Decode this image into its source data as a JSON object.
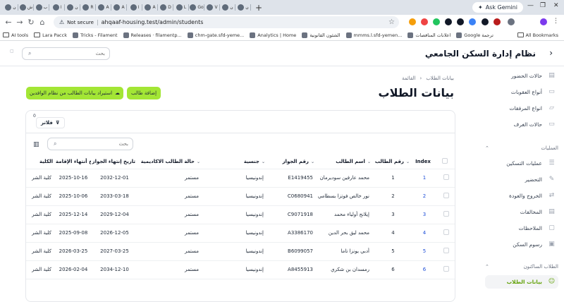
{
  "browser": {
    "tabs": [
      "ن",
      "ش",
      "ب",
      "ا",
      "ن",
      "R",
      "A",
      "A",
      "ا",
      "A",
      "D",
      "L",
      "Go",
      "V",
      "ن",
      "ن"
    ],
    "active_tab_label": "ن",
    "new_tab": "+",
    "ask_gemini": "Ask Gemini",
    "not_secure": "Not secure",
    "url": "ahqaaf-housing.test/admin/students",
    "bookmarks": [
      "AI tools",
      "Lara Pacck",
      "Tricks - Filament",
      "Releases · filamentp...",
      "chm-gate.sfd-yeme...",
      "Analytics | Home",
      "الشئون القانونية",
      "mmms.l.sfd-yemen...",
      "اعلانات المناقصات",
      "Google ترجمة",
      "All Bookmarks"
    ]
  },
  "app": {
    "brand": "نظام إدارة السكن الجامعي",
    "search_placeholder": "بحث"
  },
  "sidebar": {
    "items_top": [
      {
        "label": "حالات الحضور",
        "icon": "clipboard-icon"
      },
      {
        "label": "أنواع العقوبات",
        "icon": "document-icon"
      },
      {
        "label": "انواع المرفقات",
        "icon": "folder-icon"
      },
      {
        "label": "حالات الغرف",
        "icon": "document-icon"
      }
    ],
    "group_operations": "العمليات",
    "items_ops": [
      {
        "label": "عمليات التسكين",
        "icon": "list-icon"
      },
      {
        "label": "التحضير",
        "icon": "pencil-icon"
      },
      {
        "label": "الخروج والعودة",
        "icon": "arrows-icon"
      },
      {
        "label": "المخالفات",
        "icon": "clipboard-icon"
      },
      {
        "label": "الملاحظات",
        "icon": "chat-icon"
      },
      {
        "label": "رسوم السكن",
        "icon": "money-icon"
      }
    ],
    "group_residents": "الطلاب الساكنون",
    "item_students": "بيانات الطلاب"
  },
  "main": {
    "breadcrumb": [
      "بيانات الطلاب",
      "القائمة"
    ],
    "title": "بيانات الطلاب",
    "add_button": "إضافة طالب",
    "import_button": "استيراد بيانات الطالب من نظام الوافدين",
    "filters_label": "فلاتر",
    "filters_count": "0",
    "table_search_placeholder": "بحث"
  },
  "table": {
    "headers": {
      "index": "Index",
      "student_no": "رقم الطالب",
      "name": "اسم الطالب",
      "passport": "رقم الجواز",
      "nationality": "جنسية",
      "academic_status": "حالة الطالب الاكاديمية",
      "passport_expiry": "تاريخ إنتهاء الجواز",
      "residence_expiry": "تاريخ أنتهاء الإقامة",
      "college": "الكلية"
    },
    "rows": [
      {
        "index": "1",
        "student_no": "1",
        "name": "محمد عارفين سوديرمان",
        "passport": "E1419455",
        "nationality": "إندونيسيا",
        "status": "مستمر",
        "passport_expiry": "2032-12-01",
        "residence_expiry": "2025-10-16",
        "college": "كلية الشر"
      },
      {
        "index": "2",
        "student_no": "2",
        "name": "نور خالص فوتزا بسطامي",
        "passport": "C0680941",
        "nationality": "إندونيسيا",
        "status": "مستمر",
        "passport_expiry": "2033-03-18",
        "residence_expiry": "2025-10-06",
        "college": "كلية الشر"
      },
      {
        "index": "3",
        "student_no": "3",
        "name": "إيلانج أولياء محمد",
        "passport": "C9071918",
        "nationality": "إندونيسيا",
        "status": "مستمر",
        "passport_expiry": "2029-12-04",
        "residence_expiry": "2025-12-14",
        "college": "كلية الشر"
      },
      {
        "index": "4",
        "student_no": "4",
        "name": "محمد ليق بحر الدين",
        "passport": "A3386170",
        "nationality": "إندونيسيا",
        "status": "مستمر",
        "passport_expiry": "2026-12-05",
        "residence_expiry": "2025-09-08",
        "college": "كلية الشر"
      },
      {
        "index": "5",
        "student_no": "5",
        "name": "أدبي يونزا تاما",
        "passport": "B6099057",
        "nationality": "إندونيسيا",
        "status": "مستمر",
        "passport_expiry": "2027-03-25",
        "residence_expiry": "2026-03-25",
        "college": "كلية الشر"
      },
      {
        "index": "6",
        "student_no": "6",
        "name": "رمسدان بن شكري",
        "passport": "A8455913",
        "nationality": "إندونيسيا",
        "status": "مستمر",
        "passport_expiry": "2034-12-10",
        "residence_expiry": "2026-02-04",
        "college": "كلية الشر"
      }
    ]
  },
  "colors": {
    "accent": "#a3e635",
    "accent_text": "#65a30d",
    "index_link": "#1d4ed8"
  }
}
